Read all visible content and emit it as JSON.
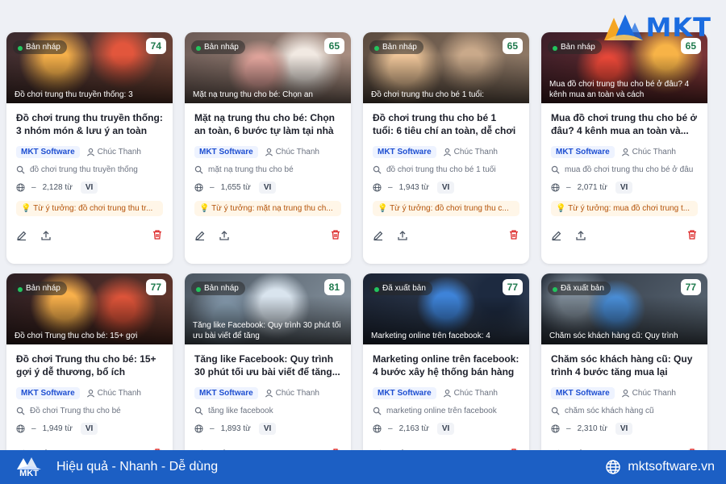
{
  "brand": {
    "logo_text": "MKT",
    "slogan": "Hiệu quả - Nhanh - Dễ dùng",
    "website": "mktsoftware.vn"
  },
  "colors": {
    "primary": "#1c5fc4",
    "score": "#1f7a4d",
    "status_dot": "#22c55e",
    "delete": "#dc2626"
  },
  "cards": [
    {
      "status": "Bản nháp",
      "score": "74",
      "thumb_caption": "Đồ chơi trung thu truyền thống: 3",
      "title": "Đồ chơi trung thu truyền thống: 3 nhóm món & lưu ý an toàn",
      "brand": "MKT Software",
      "author": "Chúc Thanh",
      "keyword": "đồ chơi trung thu truyền thống",
      "lang_icon": "globe-icon",
      "lang_dash": "–",
      "words": "2,128 từ",
      "language": "VI",
      "idea": "Từ ý tưởng: đồ chơi trung thu tr..."
    },
    {
      "status": "Bản nháp",
      "score": "65",
      "thumb_caption": "Mặt nạ trung thu cho bé: Chọn an",
      "title": "Mặt nạ trung thu cho bé: Chọn an toàn, 6 bước tự làm tại nhà",
      "brand": "MKT Software",
      "author": "Chúc Thanh",
      "keyword": "mặt nạ trung thu cho bé",
      "lang_icon": "globe-icon",
      "lang_dash": "–",
      "words": "1,655 từ",
      "language": "VI",
      "idea": "Từ ý tưởng: mặt nạ trung thu ch..."
    },
    {
      "status": "Bản nháp",
      "score": "65",
      "thumb_caption": "Đồ chơi trung thu cho bé 1 tuổi:",
      "title": "Đồ chơi trung thu cho bé 1 tuổi: 6 tiêu chí an toàn, dễ chơi",
      "brand": "MKT Software",
      "author": "Chúc Thanh",
      "keyword": "đồ chơi trung thu cho bé 1 tuổi",
      "lang_icon": "globe-icon",
      "lang_dash": "–",
      "words": "1,943 từ",
      "language": "VI",
      "idea": "Từ ý tưởng: đồ chơi trung thu c..."
    },
    {
      "status": "Bản nháp",
      "score": "65",
      "thumb_caption": "Mua đồ chơi trung thu cho bé ở đâu? 4 kênh mua an toàn và cách",
      "title": "Mua đồ chơi trung thu cho bé ở đâu? 4 kênh mua an toàn và...",
      "brand": "MKT Software",
      "author": "Chúc Thanh",
      "keyword": "mua đồ chơi trung thu cho bé ở đâu",
      "lang_icon": "globe-icon",
      "lang_dash": "–",
      "words": "2,071 từ",
      "language": "VI",
      "idea": "Từ ý tưởng: mua đồ chơi trung t..."
    },
    {
      "status": "Bản nháp",
      "score": "77",
      "thumb_caption": "Đồ chơi Trung thu cho bé: 15+ gợi",
      "title": "Đồ chơi Trung thu cho bé: 15+ gợi ý dễ thương, bổ ích",
      "brand": "MKT Software",
      "author": "Chúc Thanh",
      "keyword": "Đồ chơi Trung thu cho bé",
      "lang_icon": "globe-icon",
      "lang_dash": "–",
      "words": "1,949 từ",
      "language": "VI",
      "idea": ""
    },
    {
      "status": "Bản nháp",
      "score": "81",
      "thumb_caption": "Tăng like Facebook: Quy trình 30 phút tối ưu bài viết để tăng",
      "title": "Tăng like Facebook: Quy trình 30 phút tối ưu bài viết để tăng...",
      "brand": "MKT Software",
      "author": "Chúc Thanh",
      "keyword": "tăng like facebook",
      "lang_icon": "globe-icon",
      "lang_dash": "–",
      "words": "1,893 từ",
      "language": "VI",
      "idea": ""
    },
    {
      "status": "Đã xuất bản",
      "score": "77",
      "thumb_caption": "Marketing online trên facebook: 4",
      "title": "Marketing online trên facebook: 4 bước xây hệ thống bán hàng",
      "brand": "MKT Software",
      "author": "Chúc Thanh",
      "keyword": "marketing online trên facebook",
      "lang_icon": "globe-icon",
      "lang_dash": "–",
      "words": "2,163 từ",
      "language": "VI",
      "idea": ""
    },
    {
      "status": "Đã xuất bản",
      "score": "77",
      "thumb_caption": "Chăm sóc khách hàng cũ: Quy trình",
      "title": "Chăm sóc khách hàng cũ: Quy trình 4 bước tăng mua lại nhanh",
      "brand": "MKT Software",
      "author": "Chúc Thanh",
      "keyword": "chăm sóc khách hàng cũ",
      "lang_icon": "globe-icon",
      "lang_dash": "–",
      "words": "2,310 từ",
      "language": "VI",
      "idea": ""
    }
  ]
}
